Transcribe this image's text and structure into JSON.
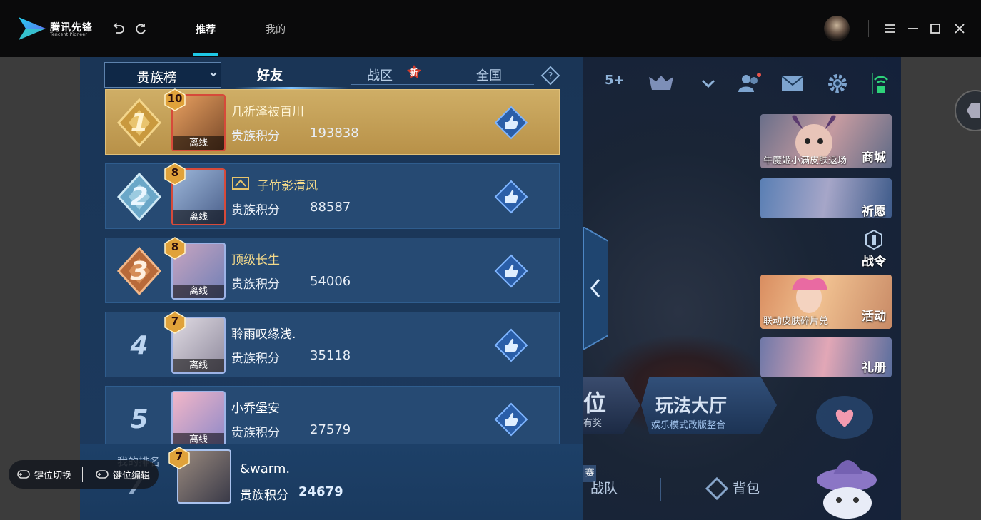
{
  "titlebar": {
    "brand": "腾讯先锋",
    "brand_sub": "Tencent Pioneer",
    "tabs": [
      {
        "label": "推荐",
        "active": true
      },
      {
        "label": "我的",
        "active": false
      }
    ],
    "accent": "#1ec8e6"
  },
  "leaderboard": {
    "dropdown": "贵族榜",
    "tabs": [
      {
        "label": "好友",
        "active": true
      },
      {
        "label": "战区",
        "badge": "新"
      },
      {
        "label": "全国"
      }
    ],
    "rows": [
      {
        "rank": "1",
        "level": "10",
        "name": "几祈泽被百川",
        "score_label": "贵族积分",
        "score": "193838",
        "status": "离线",
        "highlight": true
      },
      {
        "rank": "2",
        "level": "8",
        "name": "子竹影清风",
        "score_label": "贵族积分",
        "score": "88587",
        "status": "离线"
      },
      {
        "rank": "3",
        "level": "8",
        "name": "顶级长生",
        "score_label": "贵族积分",
        "score": "54006",
        "status": "离线"
      },
      {
        "rank": "4",
        "level": "7",
        "name": "聆雨叹缘浅.",
        "score_label": "贵族积分",
        "score": "35118",
        "status": "离线"
      },
      {
        "rank": "5",
        "level": "",
        "name": "小乔堡安",
        "score_label": "贵族积分",
        "score": "27579",
        "status": "离线"
      }
    ],
    "mine": {
      "label": "我的排名",
      "rank": "7",
      "level": "7",
      "name": "&warm.",
      "score_label": "贵族积分",
      "score": "24679"
    }
  },
  "game": {
    "top": {
      "plus": "5+"
    },
    "cards": [
      {
        "label": "商城",
        "sub": "牛魔姬小满皮肤返场"
      },
      {
        "label": "祈愿",
        "sub": ""
      },
      {
        "label": "战令",
        "sub": ""
      },
      {
        "label": "活动",
        "sub": "联动皮肤碎片兑"
      },
      {
        "label": "礼册",
        "sub": ""
      }
    ],
    "rank_btn": {
      "label": "位",
      "sub": "有奖"
    },
    "mode_btn": {
      "label": "玩法大厅",
      "sub": "娱乐模式改版整合"
    },
    "bottom": {
      "team": "战队",
      "bag": "背包",
      "tag": "赛"
    }
  },
  "overlay": {
    "switch": "键位切换",
    "edit": "键位编辑"
  }
}
